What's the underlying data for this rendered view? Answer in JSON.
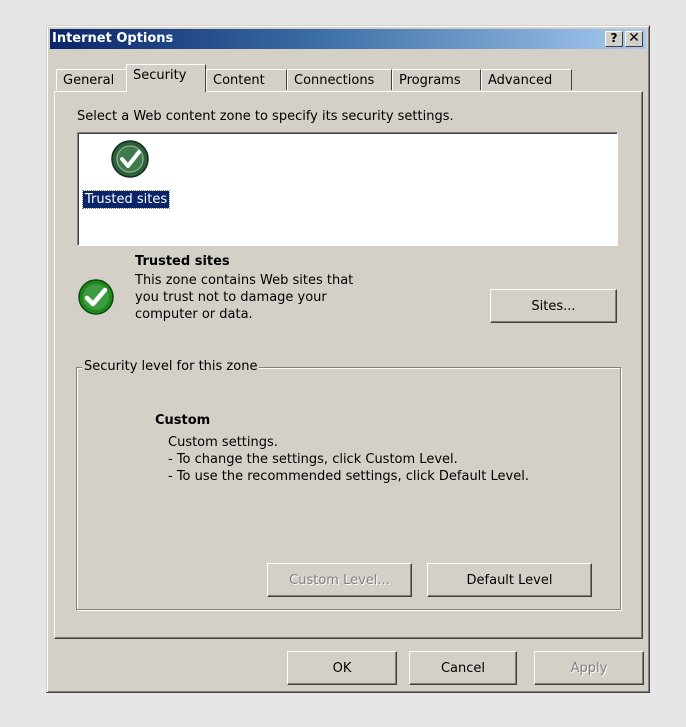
{
  "window": {
    "title": "Internet Options",
    "help_label": "?",
    "close_label": "✕"
  },
  "tabs": [
    {
      "label": "General"
    },
    {
      "label": "Security",
      "active": true
    },
    {
      "label": "Content"
    },
    {
      "label": "Connections"
    },
    {
      "label": "Programs"
    },
    {
      "label": "Advanced"
    }
  ],
  "security": {
    "instruction": "Select a Web content zone to specify its security settings.",
    "zones": [
      {
        "label": "Trusted sites",
        "icon": "check-circle-icon",
        "selected": true
      }
    ],
    "selected_zone": {
      "title": "Trusted sites",
      "description_lines": [
        "This zone contains Web sites that",
        "you trust not to damage your",
        "computer or data."
      ],
      "sites_button": "Sites..."
    },
    "level_group": {
      "legend": "Security level for this zone",
      "level_title": "Custom",
      "level_lines": [
        "Custom settings.",
        "- To change the settings, click Custom Level.",
        "- To use the recommended settings, click Default Level."
      ],
      "custom_level_button": "Custom Level...",
      "default_level_button": "Default Level"
    }
  },
  "footer": {
    "ok": "OK",
    "cancel": "Cancel",
    "apply": "Apply"
  },
  "colors": {
    "title_start": "#0a246a",
    "title_end": "#a6caf0",
    "face": "#d4d0c8",
    "selection": "#0a246a",
    "check_green": "#1e8a1e"
  }
}
